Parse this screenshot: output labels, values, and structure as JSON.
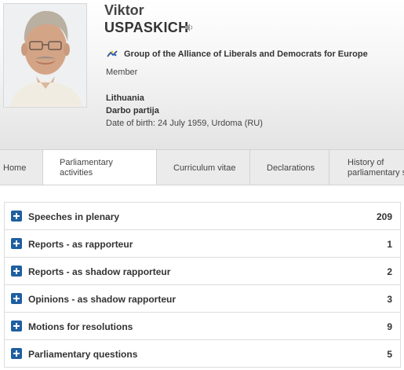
{
  "profile": {
    "first_name": "Viktor",
    "last_name": "USPASKICH",
    "group": "Group of the Alliance of Liberals and Democrats for Europe",
    "role": "Member",
    "country": "Lithuania",
    "party": "Darbo partija",
    "date_of_birth": "Date of birth: 24 July 1959, Urdoma (RU)"
  },
  "tabs": [
    {
      "line1": "Home",
      "line2": ""
    },
    {
      "line1": "Parliamentary",
      "line2": "activities"
    },
    {
      "line1": "Curriculum vitae",
      "line2": ""
    },
    {
      "line1": "Declarations",
      "line2": ""
    },
    {
      "line1": "History of",
      "line2": "parliamentary s"
    }
  ],
  "activities": [
    {
      "label": "Speeches in plenary",
      "count": "209"
    },
    {
      "label": "Reports - as rapporteur",
      "count": "1"
    },
    {
      "label": "Reports - as shadow rapporteur",
      "count": "2"
    },
    {
      "label": "Opinions - as shadow rapporteur",
      "count": "3"
    },
    {
      "label": "Motions for resolutions",
      "count": "9"
    },
    {
      "label": "Parliamentary questions",
      "count": "5"
    }
  ],
  "colors": {
    "accent": "#1f5fa0",
    "group_logo": "#2a5aa8",
    "group_logo_yellow": "#f2c200"
  },
  "icons": {
    "speaker": "speaker-icon",
    "expand": "plus-icon",
    "group": "alde-logo-icon"
  }
}
